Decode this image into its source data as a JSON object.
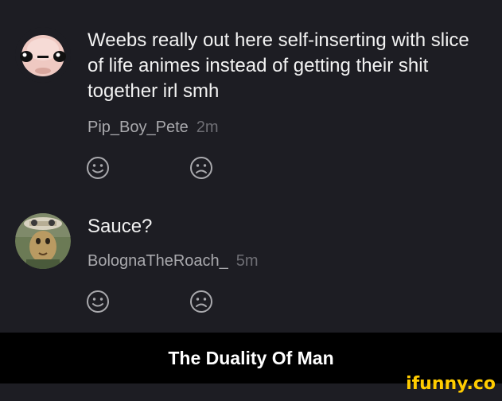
{
  "comments": [
    {
      "text": "Weebs really out here self-inserting with slice of life animes instead of getting their shit together irl smh",
      "username": "Pip_Boy_Pete",
      "time": "2m"
    },
    {
      "text": "Sauce?",
      "username": "BolognaTheRoach_",
      "time": "5m"
    }
  ],
  "caption": "The Duality Of Man",
  "watermark": "ifunny.co",
  "colors": {
    "background": "#1d1d23",
    "caption_bar": "#000000",
    "watermark": "#ffcc00"
  },
  "icons": [
    "smile-icon",
    "frown-icon"
  ]
}
